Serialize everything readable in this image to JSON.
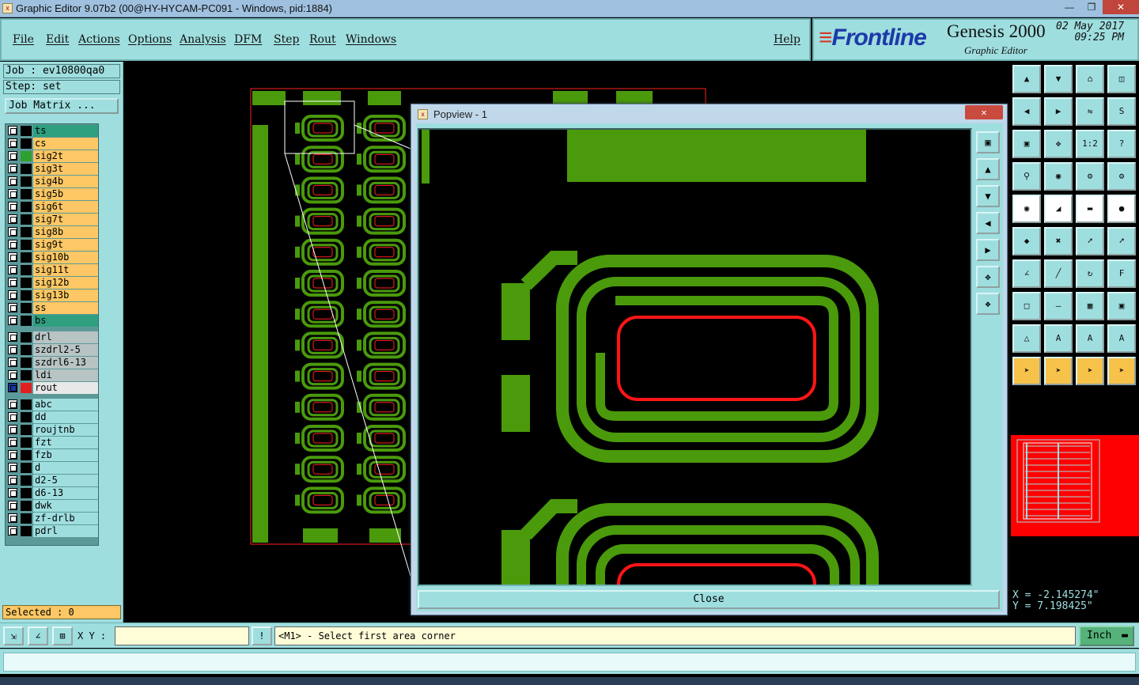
{
  "window": {
    "title": "Graphic Editor 9.07b2 (00@HY-HYCAM-PC091 - Windows, pid:1884)",
    "app_icon": "editor-icon",
    "controls": [
      "minimize-icon",
      "restore-icon",
      "close-icon"
    ]
  },
  "menu": {
    "items": [
      {
        "label": "File"
      },
      {
        "label": "Edit"
      },
      {
        "label": "Actions"
      },
      {
        "label": "Options"
      },
      {
        "label": "Analysis"
      },
      {
        "label": "DFM"
      },
      {
        "label": "Step"
      },
      {
        "label": "Rout"
      },
      {
        "label": "Windows"
      }
    ],
    "help": "Help"
  },
  "brand": {
    "logo": "Frontline",
    "product": "Genesis 2000",
    "subtitle": "Graphic Editor",
    "date": "02 May 2017",
    "time": "09:25 PM"
  },
  "left": {
    "job": "Job : ev10800qa0",
    "step": "Step: set",
    "job_matrix": "Job Matrix ...",
    "layers": [
      {
        "name": "ts",
        "color": "#2f9f7f"
      },
      {
        "name": "cs",
        "color": "#fcc764"
      },
      {
        "name": "sig2t",
        "color": "#fcc764",
        "ind": "#2f9f2f"
      },
      {
        "name": "sig3t",
        "color": "#fcc764"
      },
      {
        "name": "sig4b",
        "color": "#fcc764"
      },
      {
        "name": "sig5b",
        "color": "#fcc764"
      },
      {
        "name": "sig6t",
        "color": "#fcc764"
      },
      {
        "name": "sig7t",
        "color": "#fcc764"
      },
      {
        "name": "sig8b",
        "color": "#fcc764"
      },
      {
        "name": "sig9t",
        "color": "#fcc764"
      },
      {
        "name": "sig10b",
        "color": "#fcc764"
      },
      {
        "name": "sig11t",
        "color": "#fcc764"
      },
      {
        "name": "sig12b",
        "color": "#fcc764"
      },
      {
        "name": "sig13b",
        "color": "#fcc764"
      },
      {
        "name": "ss",
        "color": "#fcc764"
      },
      {
        "name": "bs",
        "color": "#2f9f7f"
      },
      {
        "name": "drl",
        "color": "#b8c4c4",
        "gap": true
      },
      {
        "name": "szdrl2-5",
        "color": "#b8c4c4"
      },
      {
        "name": "szdrl6-13",
        "color": "#b8c4c4"
      },
      {
        "name": "ldi",
        "color": "#b8c4c4"
      },
      {
        "name": "rout",
        "color": "#e8e8e8",
        "ind": "#e02020",
        "active": true
      },
      {
        "name": "abc",
        "color": "#9fdedf",
        "gap": true
      },
      {
        "name": "dd",
        "color": "#9fdedf"
      },
      {
        "name": "roujtnb",
        "color": "#9fdedf"
      },
      {
        "name": "fzt",
        "color": "#9fdedf"
      },
      {
        "name": "fzb",
        "color": "#9fdedf"
      },
      {
        "name": "d",
        "color": "#9fdedf"
      },
      {
        "name": "d2-5",
        "color": "#9fdedf"
      },
      {
        "name": "d6-13",
        "color": "#9fdedf"
      },
      {
        "name": "dwk",
        "color": "#9fdedf"
      },
      {
        "name": "zf-drlb",
        "color": "#9fdedf"
      },
      {
        "name": "pdrl",
        "color": "#9fdedf"
      }
    ],
    "selected": "Selected : 0"
  },
  "popup": {
    "title": "Popview - 1",
    "close_label": "Close"
  },
  "coords": {
    "x": "X = -2.145274\"",
    "y": "Y = 7.198425\""
  },
  "status": {
    "xy_label": "X Y :",
    "xy_value": "",
    "message": "<M1> - Select first area corner",
    "units": "Inch"
  },
  "colors": {
    "board_green": "#4a9a0c",
    "rout_red": "#ff2020",
    "panel_cyan": "#9fdedf",
    "layer_orange": "#fcc764"
  }
}
